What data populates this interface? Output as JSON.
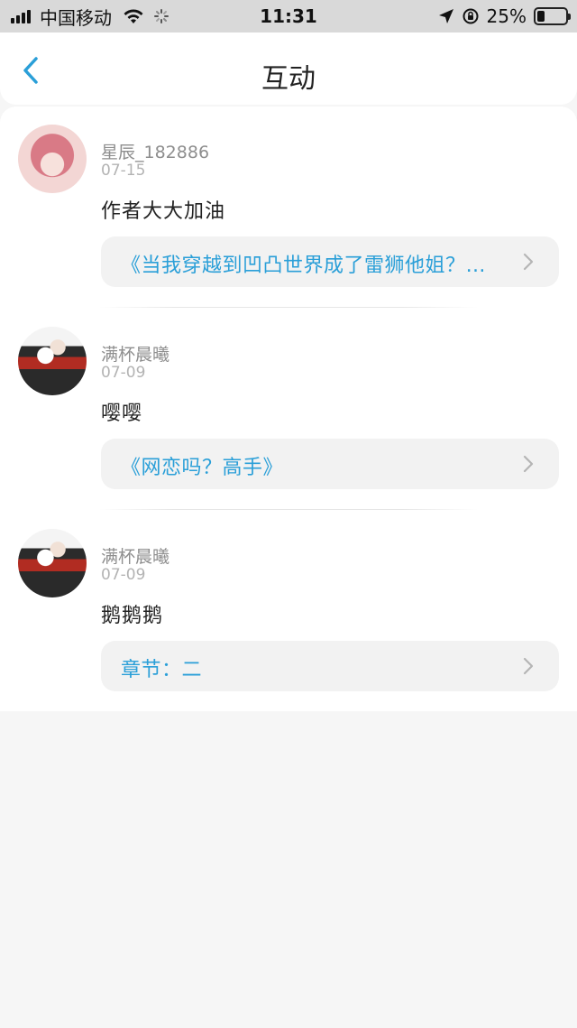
{
  "status_bar": {
    "carrier": "中国移动",
    "time": "11:31",
    "battery_pct": "25%",
    "battery_level": 0.25
  },
  "nav": {
    "title": "互动",
    "accent": "#2a9fd8"
  },
  "items": [
    {
      "user": "星辰_182886",
      "date": "07-15",
      "comment": "作者大大加油",
      "link": "《当我穿越到凹凸世界成了雷狮他姐？…"
    },
    {
      "user": "满杯晨曦",
      "date": "07-09",
      "comment": "嘤嘤",
      "link": "《网恋吗？高手》"
    },
    {
      "user": "满杯晨曦",
      "date": "07-09",
      "comment": "鹅鹅鹅",
      "link": "章节：二"
    }
  ]
}
